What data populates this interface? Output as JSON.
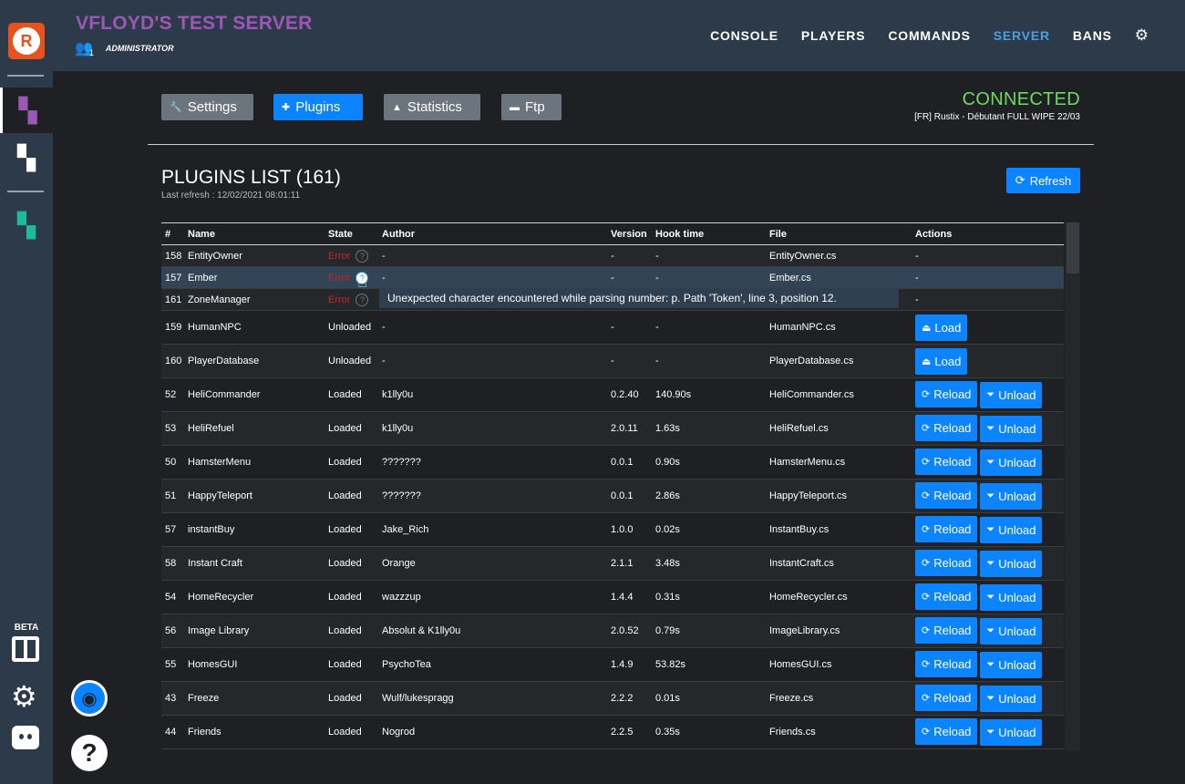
{
  "header": {
    "server_title": "VFLOYD'S TEST SERVER",
    "role": "ADMINISTRATOR",
    "user_count": "1",
    "nav": [
      {
        "label": "CONSOLE"
      },
      {
        "label": "PLAYERS"
      },
      {
        "label": "COMMANDS"
      },
      {
        "label": "SERVER"
      },
      {
        "label": "BANS"
      }
    ],
    "active_nav": "SERVER"
  },
  "sidebar": {
    "beta_label": "BETA"
  },
  "tabs": [
    {
      "label": "Settings",
      "icon": "wrench-icon"
    },
    {
      "label": "Plugins",
      "icon": "puzzle-icon"
    },
    {
      "label": "Statistics",
      "icon": "chart-icon"
    },
    {
      "label": "Ftp",
      "icon": "folder-icon"
    }
  ],
  "connection": {
    "status": "CONNECTED",
    "server_name": "[FR] Rustix - Débutant FULL WIPE 22/03"
  },
  "plugins": {
    "title": "PLUGINS LIST (161)",
    "last_refresh": "Last refresh : 12/02/2021 08:01:11",
    "refresh_label": "Refresh",
    "columns": [
      "#",
      "Name",
      "State",
      "Author",
      "Version",
      "Hook time",
      "File",
      "Actions"
    ],
    "tooltip": "Unexpected character encountered while parsing number: p. Path 'Token', line 3, position 12.",
    "rows": [
      {
        "id": "158",
        "name": "EntityOwner",
        "state": "Error",
        "author": "-",
        "version": "-",
        "hook": "-",
        "file": "EntityOwner.cs",
        "actions": "-"
      },
      {
        "id": "157",
        "name": "Ember",
        "state": "Error",
        "author": "-",
        "version": "-",
        "hook": "-",
        "file": "Ember.cs",
        "actions": "-"
      },
      {
        "id": "161",
        "name": "ZoneManager",
        "state": "Error",
        "author": "",
        "version": "",
        "hook": "",
        "file": "",
        "actions": "-"
      },
      {
        "id": "159",
        "name": "HumanNPC",
        "state": "Unloaded",
        "author": "-",
        "version": "-",
        "hook": "-",
        "file": "HumanNPC.cs",
        "actions": "load"
      },
      {
        "id": "160",
        "name": "PlayerDatabase",
        "state": "Unloaded",
        "author": "-",
        "version": "-",
        "hook": "-",
        "file": "PlayerDatabase.cs",
        "actions": "load"
      },
      {
        "id": "52",
        "name": "HeliCommander",
        "state": "Loaded",
        "author": "k1lly0u",
        "version": "0.2.40",
        "hook": "140.90s",
        "file": "HeliCommander.cs",
        "actions": "reload"
      },
      {
        "id": "53",
        "name": "HeliRefuel",
        "state": "Loaded",
        "author": "k1lly0u",
        "version": "2.0.11",
        "hook": "1.63s",
        "file": "HeliRefuel.cs",
        "actions": "reload"
      },
      {
        "id": "50",
        "name": "HamsterMenu",
        "state": "Loaded",
        "author": "???????",
        "version": "0.0.1",
        "hook": "0.90s",
        "file": "HamsterMenu.cs",
        "actions": "reload"
      },
      {
        "id": "51",
        "name": "HappyTeleport",
        "state": "Loaded",
        "author": "???????",
        "version": "0.0.1",
        "hook": "2.86s",
        "file": "HappyTeleport.cs",
        "actions": "reload"
      },
      {
        "id": "57",
        "name": "instantBuy",
        "state": "Loaded",
        "author": "Jake_Rich",
        "version": "1.0.0",
        "hook": "0.02s",
        "file": "InstantBuy.cs",
        "actions": "reload"
      },
      {
        "id": "58",
        "name": "Instant Craft",
        "state": "Loaded",
        "author": "Orange",
        "version": "2.1.1",
        "hook": "3.48s",
        "file": "InstantCraft.cs",
        "actions": "reload"
      },
      {
        "id": "54",
        "name": "HomeRecycler",
        "state": "Loaded",
        "author": "wazzzup",
        "version": "1.4.4",
        "hook": "0.31s",
        "file": "HomeRecycler.cs",
        "actions": "reload"
      },
      {
        "id": "56",
        "name": "Image Library",
        "state": "Loaded",
        "author": "Absolut & K1lly0u",
        "version": "2.0.52",
        "hook": "0.79s",
        "file": "ImageLibrary.cs",
        "actions": "reload"
      },
      {
        "id": "55",
        "name": "HomesGUI",
        "state": "Loaded",
        "author": "PsychoTea",
        "version": "1.4.9",
        "hook": "53.82s",
        "file": "HomesGUI.cs",
        "actions": "reload"
      },
      {
        "id": "43",
        "name": "Freeze",
        "state": "Loaded",
        "author": "Wulf/lukespragg",
        "version": "2.2.2",
        "hook": "0.01s",
        "file": "Freeze.cs",
        "actions": "reload"
      },
      {
        "id": "44",
        "name": "Friends",
        "state": "Loaded",
        "author": "Nogrod",
        "version": "2.2.5",
        "hook": "0.35s",
        "file": "Friends.cs",
        "actions": "reload"
      }
    ],
    "labels": {
      "load": "Load",
      "reload": "Reload",
      "unload": "Unload"
    }
  },
  "colors": {
    "accent": "#0d84ff",
    "connected": "#6fda5f",
    "error": "#c0282d",
    "title": "#9b59b6"
  }
}
